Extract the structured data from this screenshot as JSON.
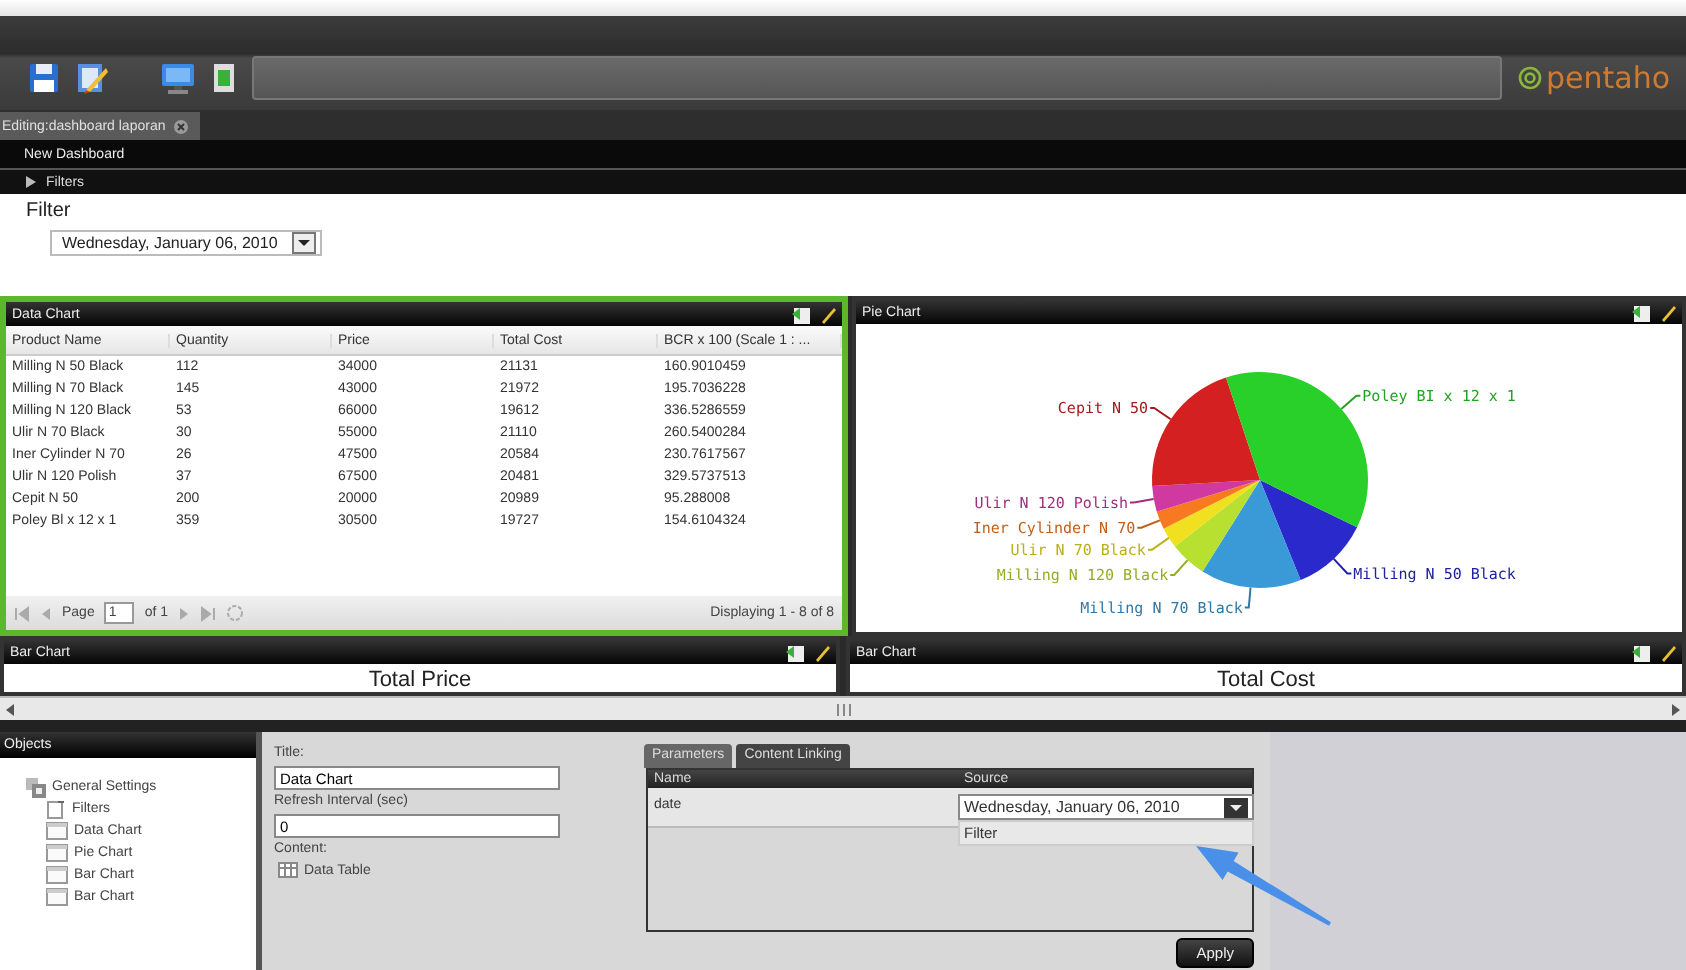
{
  "toolbar": {
    "logo": "pentaho"
  },
  "tabs": [
    {
      "label": "Editing:dashboard laporan",
      "selected": true
    }
  ],
  "dashboard_title": "New Dashboard",
  "filters_bar": {
    "label": "Filters",
    "expanded": false
  },
  "filter": {
    "label": "Filter",
    "date": "Wednesday, January 06, 2010"
  },
  "data_panel": {
    "title": "Data Chart",
    "selected": true,
    "columns": [
      "Product Name",
      "Quantity",
      "Price",
      "Total Cost",
      "BCR x 100 (Scale 1 : ..."
    ],
    "rows": [
      [
        "Milling N 50 Black",
        "112",
        "34000",
        "21131",
        "160.9010459"
      ],
      [
        "Milling N 70 Black",
        "145",
        "43000",
        "21972",
        "195.7036228"
      ],
      [
        "Milling N 120 Black",
        "53",
        "66000",
        "19612",
        "336.5286559"
      ],
      [
        "Ulir N 70 Black",
        "30",
        "55000",
        "21110",
        "260.5400284"
      ],
      [
        "Iner Cylinder N 70",
        "26",
        "47500",
        "20584",
        "230.7617567"
      ],
      [
        "Ulir N 120 Polish",
        "37",
        "67500",
        "20481",
        "329.5737513"
      ],
      [
        "Cepit N 50",
        "200",
        "20000",
        "20989",
        "95.288008"
      ],
      [
        "Poley Bl x 12 x 1",
        "359",
        "30500",
        "19727",
        "154.6104324"
      ]
    ],
    "pager": {
      "page_label": "Page",
      "page": "1",
      "of": "of 1",
      "status": "Displaying 1 - 8 of 8"
    }
  },
  "pie_panel": {
    "title": "Pie Chart",
    "selected": false,
    "chart_data": {
      "type": "pie",
      "categories": [
        "Milling N 50 Black",
        "Milling N 70 Black",
        "Milling N 120 Black",
        "Ulir N 70 Black",
        "Iner Cylinder N 70",
        "Ulir N 120 Polish",
        "Cepit N 50",
        "Poley BI x 12 x 1"
      ],
      "values": [
        11.64,
        15.07,
        5.51,
        3.12,
        2.7,
        3.85,
        20.79,
        37.32
      ],
      "colors": [
        "#2a2acc",
        "#3a9ad8",
        "#b8e030",
        "#f0e020",
        "#f87a20",
        "#d03aa0",
        "#d42020",
        "#2ad02a"
      ]
    }
  },
  "bar_panels": [
    {
      "title": "Bar Chart",
      "chart_title": "Total Price"
    },
    {
      "title": "Bar Chart",
      "chart_title": "Total Cost"
    }
  ],
  "objects": {
    "title": "Objects",
    "tree": [
      {
        "label": "General Settings",
        "kind": "settings",
        "children": [
          {
            "label": "Filters",
            "kind": "filter"
          },
          {
            "label": "Data Chart",
            "kind": "panel"
          },
          {
            "label": "Pie Chart",
            "kind": "panel"
          },
          {
            "label": "Bar Chart",
            "kind": "panel"
          },
          {
            "label": "Bar Chart",
            "kind": "panel"
          }
        ]
      }
    ]
  },
  "properties": {
    "title_label": "Title:",
    "title_value": "Data Chart",
    "refresh_label": "Refresh Interval (sec)",
    "refresh_value": "0",
    "content_label": "Content:",
    "content_value": "Data Table"
  },
  "parameters": {
    "tabs": [
      {
        "label": "Parameters",
        "selected": true
      },
      {
        "label": "Content Linking",
        "selected": false
      }
    ],
    "columns": [
      "Name",
      "Source"
    ],
    "rows": [
      {
        "name": "date",
        "source": "Wednesday, January 06, 2010",
        "expanded": true,
        "options": [
          "Filter"
        ]
      }
    ],
    "apply": "Apply"
  }
}
